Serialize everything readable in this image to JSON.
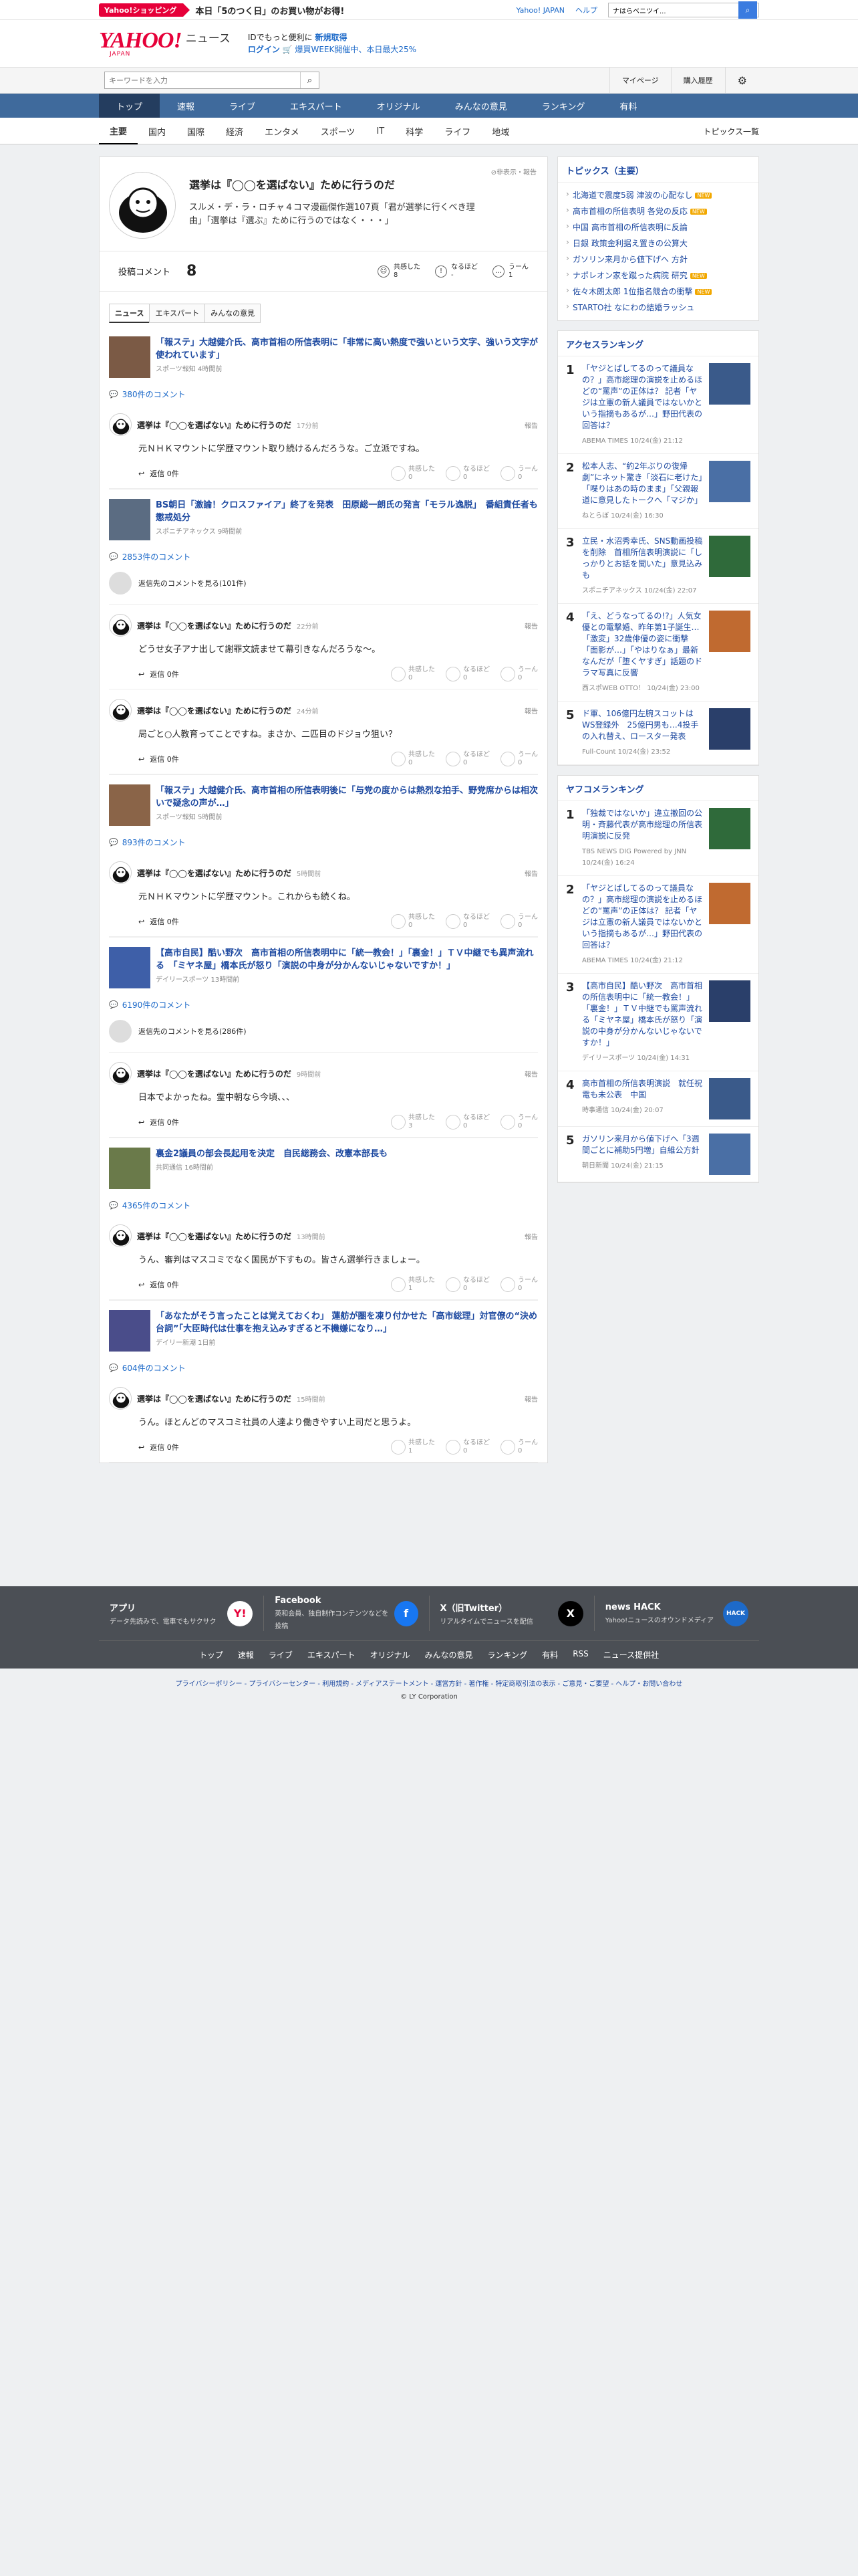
{
  "promo": {
    "tag": "Yahoo!ショッピング",
    "text": "本日「5のつく日」のお買い物がお得!",
    "links": [
      "Yahoo! JAPAN",
      "ヘルプ"
    ],
    "search_placeholder": "ウェブ検索",
    "search_value": "ナはらベニツイ..."
  },
  "header": {
    "logo": "YAHOO!",
    "logo_sub": "JAPAN",
    "service": "ニュース",
    "msg1": "IDでもっと便利に",
    "msg1_link": "新規取得",
    "msg2_link": "ログイン",
    "msg2": "🛒 爆買WEEK開催中、本日最大25%"
  },
  "search": {
    "placeholder": "キーワードを入力",
    "mypage": "マイページ",
    "history": "購入履歴"
  },
  "nav": [
    "トップ",
    "速報",
    "ライブ",
    "エキスパート",
    "オリジナル",
    "みんなの意見",
    "ランキング",
    "有料"
  ],
  "subnav": [
    "主要",
    "国内",
    "国際",
    "経済",
    "エンタメ",
    "スポーツ",
    "IT",
    "科学",
    "ライフ",
    "地域"
  ],
  "subnav_more": "トピックス一覧",
  "article": {
    "title": "選挙は『◯◯を選ばない』ために行うのだ",
    "desc": "スルメ・デ・ラ・ロチャ４コマ漫画傑作選107頁「君が選挙に行くべき理由」「選挙は『選ぶ』ために行うのではなく・・・」",
    "report": "非表示・報告",
    "comment_label": "投稿コメント",
    "comment_count": "8",
    "reactions": [
      {
        "label": "共感した",
        "count": "8"
      },
      {
        "label": "なるほど",
        "count": "-"
      },
      {
        "label": "うーん",
        "count": "1"
      }
    ]
  },
  "tabs": [
    "ニュース",
    "エキスパート",
    "みんなの意見"
  ],
  "items": [
    {
      "title": "「報ステ」大越健介氏、高市首相の所信表明に「非常に高い熱度で強いという文字、強いう文字が使われています」",
      "source": "スポーツ報知 4時間前",
      "ccount": "380件のコメント",
      "seeprev": "",
      "comments": [
        {
          "name": "選挙は『◯◯を選ばない』ために行うのだ",
          "time": "17分前",
          "text": "元ＮＨＫマウントに学歴マウント取り続けるんだろうな。ご立派ですね。",
          "r": [
            "0",
            "0",
            "0"
          ]
        }
      ]
    },
    {
      "title": "BS朝日「激論！クロスファイア」終了を発表　田原総一朗氏の発言「モラル逸脱」　番組責任者も懲戒処分",
      "source": "スポニチアネックス 9時間前",
      "ccount": "2853件のコメント",
      "seeprev": "返信先のコメントを見る(101件)",
      "comments": [
        {
          "name": "選挙は『◯◯を選ばない』ために行うのだ",
          "time": "22分前",
          "text": "どうせ女子アナ出して謝罪文読ませて幕引きなんだろうな～。",
          "r": [
            "0",
            "0",
            "0"
          ]
        },
        {
          "name": "選挙は『◯◯を選ばない』ために行うのだ",
          "time": "24分前",
          "text": "局ごと○人教育ってことですね。まさか、二匹目のドジョウ狙い？",
          "r": [
            "0",
            "0",
            "0"
          ]
        }
      ]
    },
    {
      "title": "「報ステ」大越健介氏、高市首相の所信表明後に「与党の度からは熱烈な拍手、野党席からは相次いで疑念の声が…」",
      "source": "スポーツ報知 5時間前",
      "ccount": "893件のコメント",
      "seeprev": "",
      "comments": [
        {
          "name": "選挙は『◯◯を選ばない』ために行うのだ",
          "time": "5時間前",
          "text": "元ＮＨＫマウントに学歴マウント。これからも続くね。",
          "r": [
            "0",
            "0",
            "0"
          ]
        }
      ]
    },
    {
      "title": "【高市自民】酷い野次　高市首相の所信表明中に「統一教会！」「裏金！」ＴＶ中継でも異声流れる　「ミヤネ屋」橋本氏が怒り「演説の中身が分かんないじゃないですか！」",
      "source": "デイリースポーツ 13時間前",
      "ccount": "6190件のコメント",
      "seeprev": "返信先のコメントを見る(286件)",
      "comments": [
        {
          "name": "選挙は『◯◯を選ばない』ために行うのだ",
          "time": "9時間前",
          "text": "日本でよかったね。霊中朝なら今頃、、、",
          "r": [
            "3",
            "0",
            "0"
          ]
        }
      ]
    },
    {
      "title": "裏金2議員の部会長起用を決定　自民総務会、改憲本部長も",
      "source": "共同通信 16時間前",
      "ccount": "4365件のコメント",
      "seeprev": "",
      "comments": [
        {
          "name": "選挙は『◯◯を選ばない』ために行うのだ",
          "time": "13時間前",
          "text": "うん、審判はマスコミでなく国民が下すもの。皆さん選挙行きましょー。",
          "r": [
            "1",
            "0",
            "0"
          ]
        }
      ]
    },
    {
      "title": "「あなたがそう言ったことは覚えておくわ」 蓮舫が圏を凍り付かせた「高市総理」対官僚の“決め台詞”「大臣時代は仕事を抱え込みすぎると不機嫌になり…」",
      "source": "デイリー新潮 1日前",
      "ccount": "604件のコメント",
      "seeprev": "",
      "comments": [
        {
          "name": "選挙は『◯◯を選ばない』ために行うのだ",
          "time": "15時間前",
          "text": "うん。ほとんどのマスコミ社員の人達より働きやすい上司だと思うよ。",
          "r": [
            "1",
            "0",
            "0"
          ]
        }
      ]
    }
  ],
  "reply_label": "返信 0件",
  "react_labels": [
    "共感した",
    "なるほど",
    "うーん"
  ],
  "side": {
    "topics_title": "トピックス（主要）",
    "topics": [
      {
        "t": "北海道で震度5弱 津波の心配なし",
        "n": "NEW"
      },
      {
        "t": "高市首相の所信表明 各党の反応",
        "n": "NEW"
      },
      {
        "t": "中国 高市首相の所信表明に反論",
        "n": ""
      },
      {
        "t": "日銀 政策金利据え置きの公算大",
        "n": ""
      },
      {
        "t": "ガソリン来月から値下げへ 方針",
        "n": ""
      },
      {
        "t": "ナポレオン家を蹴った病院 研究",
        "n": "NEW"
      },
      {
        "t": "佐々木朗太郎 1位指名競合の衝撃",
        "n": "NEW"
      },
      {
        "t": "STARTO社 なにわの結婚ラッシュ",
        "n": ""
      }
    ],
    "access_title": "アクセスランキング",
    "access": [
      {
        "t": "「ヤジとばしてるのって議員なの？」高市総理の演説を止めるほどの“罵声”の正体は？ 記者「ヤジは立憲の新人議員ではないかという指摘もあるが…」野田代表の回答は？",
        "s": "ABEMA TIMES 10/24(金) 21:12"
      },
      {
        "t": "松本人志、“約2年ぶりの復帰劇”にネット驚き「淡石に老けた」「喋りはあの時のまま」「父親報道に意見したトークへ「マジか」",
        "s": "ねとらぼ 10/24(金) 16:30"
      },
      {
        "t": "立民・水沼秀幸氏、SNS動画投稿を削除　首相所信表明演説に「しっかりとお話を聞いた」意見込みも",
        "s": "スポニチアネックス 10/24(金) 22:07"
      },
      {
        "t": "「え、どうなってるの!?」人気女優との電撃婚、昨年第1子誕生…「激変」32歳俳優の姿に衝撃「面影が…」「やはりなぁ」最新なんだが「堕くヤすぎ」話題のドラマ写真に反響",
        "s": "西スポWEB OTTO！ 10/24(金) 23:00"
      },
      {
        "t": "ド軍、106億円左腕スコットはWS登録外　25億円男も…4投手の入れ替え、ロースター発表",
        "s": "Full-Count 10/24(金) 23:52"
      }
    ],
    "yahoo_title": "ヤフコメランキング",
    "yahoo": [
      {
        "t": "「独裁ではないか」違立撤回の公明・斉藤代表が高市総理の所信表明演説に反発",
        "s": "TBS NEWS DIG Powered by JNN 10/24(金) 16:24"
      },
      {
        "t": "「ヤジとばしてるのって議員なの？」高市総理の演説を止めるほどの“罵声”の正体は？ 記者「ヤジは立憲の新人議員ではないかという指摘もあるが…」野田代表の回答は？",
        "s": "ABEMA TIMES 10/24(金) 21:12"
      },
      {
        "t": "【高市自民】酷い野次　高市首相の所信表明中に「統一教会！」「裏金！」ＴＶ中継でも罵声流れる「ミヤネ屋」橋本氏が怒り「演説の中身が分かんないじゃないですか！」",
        "s": "デイリースポーツ 10/24(金) 14:31"
      },
      {
        "t": "高市首相の所信表明演説　就任祝電も未公表　中国",
        "s": "時事通信 10/24(金) 20:07"
      },
      {
        "t": "ガソリン来月から値下げへ「3週間ごとに補助5円増」自維公方針",
        "s": "朝日新聞 10/24(金) 21:15"
      }
    ]
  },
  "footer": {
    "apps": [
      {
        "t": "アプリ",
        "d": "データ先読みで、電車でもサクサク",
        "i": "Y!"
      },
      {
        "t": "Facebook",
        "d": "英和会員、独自制作コンテンツなどを投稿",
        "i": "f"
      },
      {
        "t": "X（旧Twitter）",
        "d": "リアルタイムでニュースを配信",
        "i": "X"
      },
      {
        "t": "news HACK",
        "d": "Yahoo!ニュースのオウンドメディア",
        "i": "HACK"
      }
    ],
    "links": [
      "トップ",
      "速報",
      "ライブ",
      "エキスパート",
      "オリジナル",
      "みんなの意見",
      "ランキング",
      "有料",
      "RSS",
      "ニュース提供社"
    ],
    "legal": "プライバシーポリシー - プライバシーセンター - 利用規約 - メディアステートメント - 運営方針 - 著作権 - 特定商取引法の表示 - ご意見・ご要望 - ヘルプ・お問い合わせ",
    "copy": "© LY Corporation"
  }
}
